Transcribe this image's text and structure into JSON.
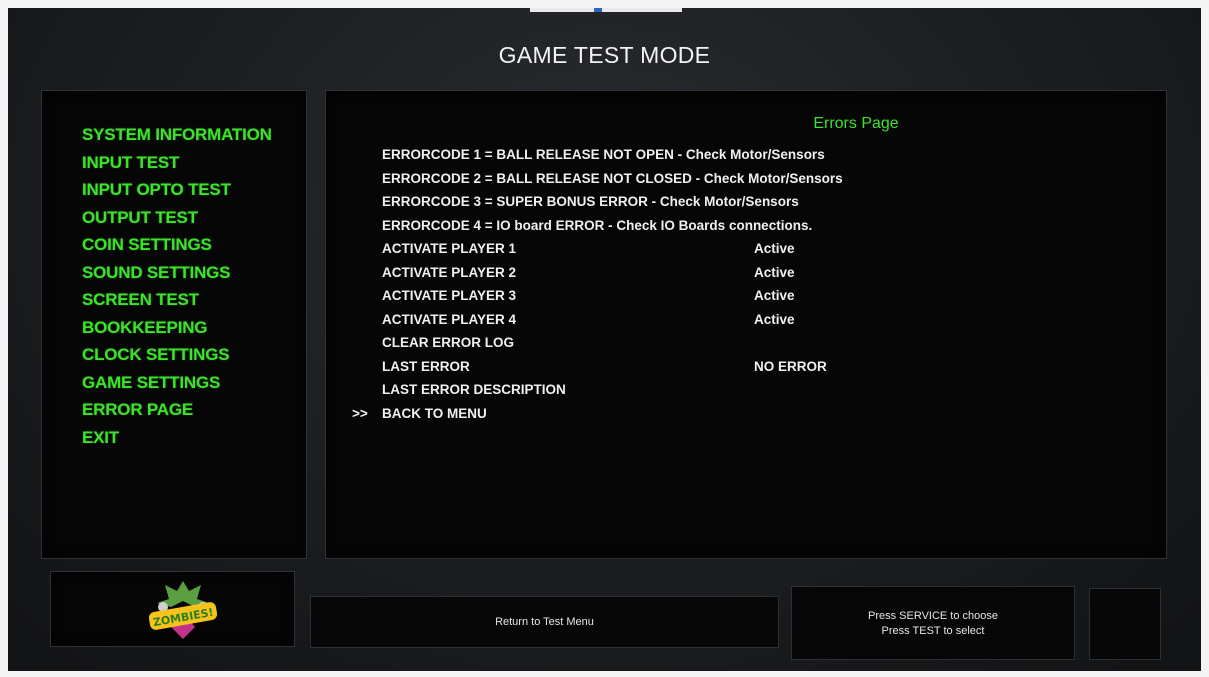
{
  "header": {
    "title": "GAME TEST MODE"
  },
  "sidebar": {
    "items": [
      "SYSTEM INFORMATION",
      "INPUT TEST",
      "INPUT OPTO TEST",
      "OUTPUT TEST",
      "COIN SETTINGS",
      "SOUND SETTINGS",
      "SCREEN TEST",
      "BOOKKEEPING",
      "CLOCK SETTINGS",
      "GAME SETTINGS",
      "ERROR PAGE",
      "EXIT"
    ]
  },
  "main": {
    "page_title": "Errors Page",
    "cursor": ">>",
    "rows": [
      {
        "label": "ERRORCODE 1 = BALL RELEASE NOT OPEN - Check Motor/Sensors",
        "value": ""
      },
      {
        "label": "ERRORCODE 2 = BALL RELEASE NOT CLOSED - Check Motor/Sensors",
        "value": ""
      },
      {
        "label": "ERRORCODE 3 = SUPER BONUS ERROR - Check Motor/Sensors",
        "value": ""
      },
      {
        "label": "ERRORCODE 4 = IO board ERROR - Check IO Boards connections.",
        "value": ""
      },
      {
        "label": "ACTIVATE PLAYER 1",
        "value": "Active"
      },
      {
        "label": "ACTIVATE PLAYER 2",
        "value": "Active"
      },
      {
        "label": "ACTIVATE PLAYER 3",
        "value": "Active"
      },
      {
        "label": "ACTIVATE PLAYER 4",
        "value": "Active"
      },
      {
        "label": "CLEAR ERROR LOG",
        "value": ""
      },
      {
        "label": "LAST ERROR",
        "value": "NO ERROR"
      },
      {
        "label": "LAST ERROR DESCRIPTION",
        "value": ""
      },
      {
        "label": "BACK TO MENU",
        "value": ""
      }
    ]
  },
  "footer": {
    "logo_text": "ZOMBIES!",
    "hint_center": "Return to Test Menu",
    "hint_right_line1": "Press SERVICE to choose",
    "hint_right_line2": "Press TEST to select"
  },
  "colors": {
    "accent_green": "#3ee22c",
    "text_white": "#f0f0f0",
    "panel_bg": "#060606"
  }
}
